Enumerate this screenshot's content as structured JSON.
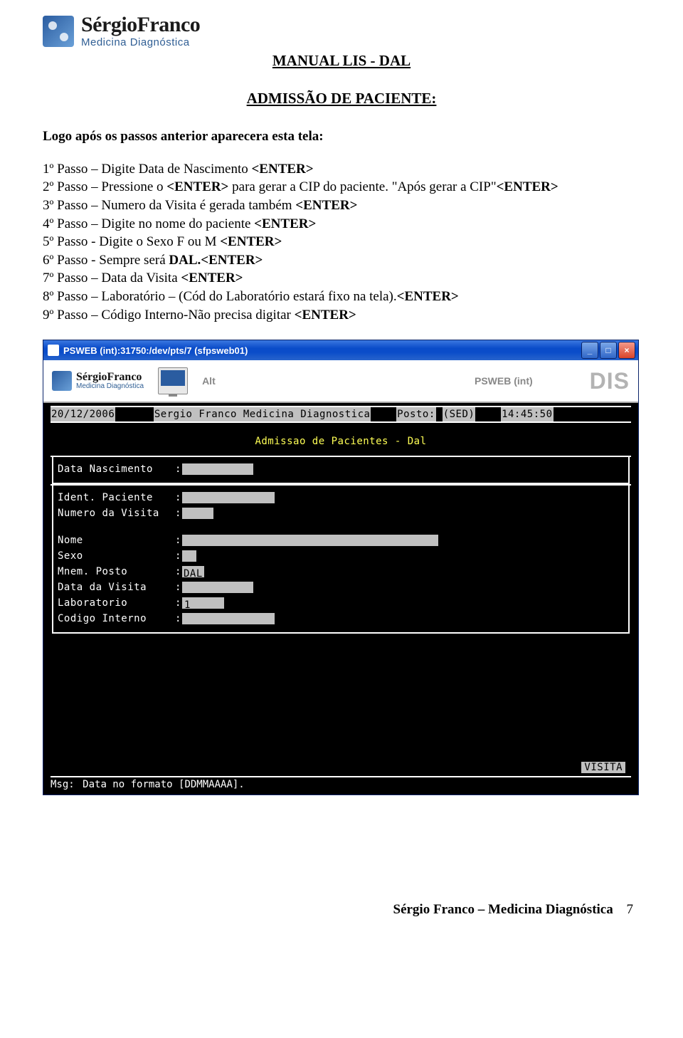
{
  "logo": {
    "line1": "SérgioFranco",
    "line2": "Medicina Diagnóstica"
  },
  "doc_title": "MANUAL LIS - DAL",
  "section_title": "ADMISSÃO DE PACIENTE:",
  "intro_text": "Logo após os passos anterior aparecera esta tela:",
  "steps": {
    "s1_pre": "1º Passo – Digite Data de Nascimento ",
    "s1_b": "<ENTER>",
    "s2_pre": "2º Passo – Pressione o ",
    "s2_b1": "<ENTER>",
    "s2_mid": " para gerar a CIP do paciente. \"Após gerar a CIP\"",
    "s2_b2": "<ENTER>",
    "s3_pre": "3º Passo – Numero da Visita  é gerada também ",
    "s3_b": "<ENTER>",
    "s4_pre": "4º Passo – Digite no nome do paciente ",
    "s4_b": "<ENTER>",
    "s5_pre": "5º Passo - Digite o Sexo F ou M ",
    "s5_b": "<ENTER>",
    "s6_pre": "6º Passo - Sempre será ",
    "s6_b1": "DAL.",
    "s6_b2": "<ENTER>",
    "s7_pre": "7º Passo – Data da Visita ",
    "s7_b": "<ENTER>",
    "s8_pre": "8º Passo – Laboratório – (Cód do Laboratório estará fixo na tela).",
    "s8_b": "<ENTER>",
    "s9_pre": "9º Passo – Código Interno-Não precisa digitar ",
    "s9_b": "<ENTER>"
  },
  "window": {
    "title": "PSWEB (int):31750:/dev/pts/7 (sfpsweb01)",
    "toolbar": {
      "logo1": "SérgioFranco",
      "logo2": "Medicina Diagnóstica",
      "alt": "Alt",
      "psweb": "PSWEB (int)",
      "dis": "DIS"
    },
    "term": {
      "date": "20/12/2006",
      "org": "Sergio Franco Medicina Diagnostica",
      "posto_lbl": "Posto:",
      "posto_val": "(SED)",
      "time": "14:45:50",
      "screen_title": "Admissao de Pacientes - Dal",
      "fields": {
        "data_nascimento": "Data Nascimento",
        "ident_paciente": "Ident. Paciente",
        "numero_visita": "Numero da Visita",
        "nome": "Nome",
        "sexo": "Sexo",
        "mnem_posto": "Mnem. Posto",
        "mnem_posto_val": "DAL",
        "data_visita": "Data da Visita",
        "laboratorio": "Laboratorio",
        "laboratorio_val": "1",
        "codigo_interno": "Codigo Interno"
      },
      "tab": "VISITA",
      "msg_label": "Msg:",
      "msg_text": "Data no formato [DDMMAAAA]."
    }
  },
  "footer": {
    "text": "Sérgio Franco – Medicina Diagnóstica",
    "page": "7"
  }
}
